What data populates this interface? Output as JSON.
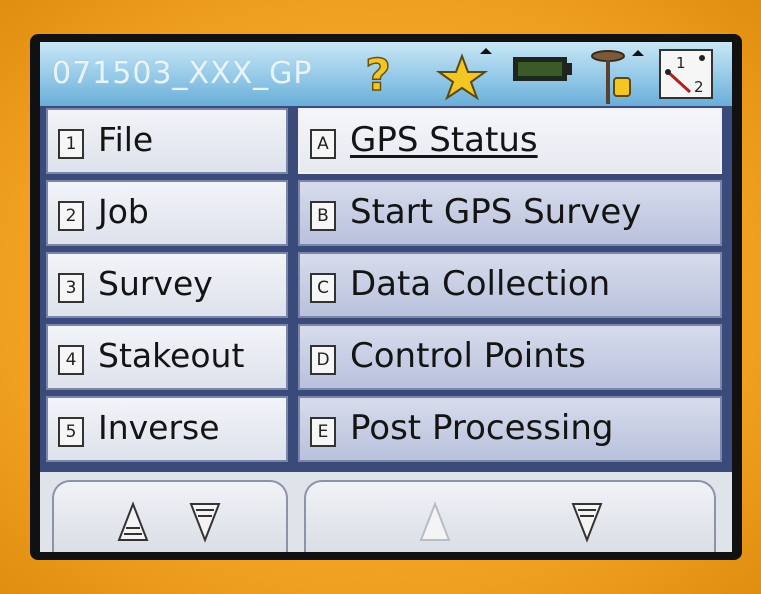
{
  "title": "071503_XXX_GP",
  "icons": {
    "help": "question-icon",
    "favorites": "star-icon",
    "battery": "battery-icon",
    "gps": "gps-antenna-icon",
    "point": "point-numbering-icon"
  },
  "left_menu": [
    {
      "key": "1",
      "label": "File"
    },
    {
      "key": "2",
      "label": "Job"
    },
    {
      "key": "3",
      "label": "Survey"
    },
    {
      "key": "4",
      "label": "Stakeout"
    },
    {
      "key": "5",
      "label": "Inverse"
    }
  ],
  "right_menu": [
    {
      "key": "A",
      "label": "GPS Status"
    },
    {
      "key": "B",
      "label": "Start GPS Survey"
    },
    {
      "key": "C",
      "label": "Data Collection"
    },
    {
      "key": "D",
      "label": "Control Points"
    },
    {
      "key": "E",
      "label": "Post Processing"
    }
  ],
  "colors": {
    "device": "#f0a020",
    "titlebar": "#8fc6e6",
    "menu_bg": "#dde2ec",
    "selected_bg": "#b9c1dc"
  }
}
